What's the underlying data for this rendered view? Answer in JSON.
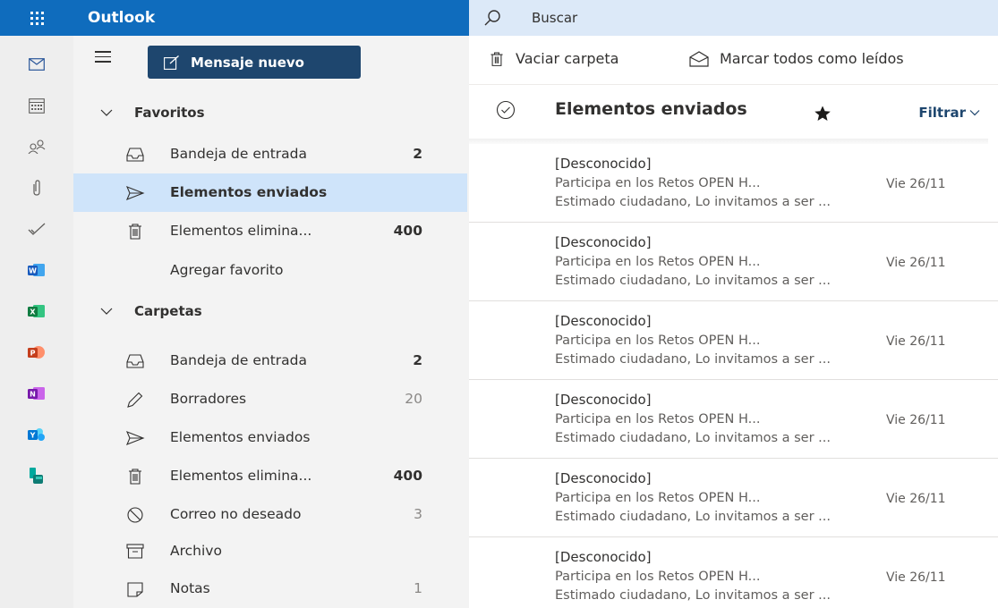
{
  "topbar": {
    "app_name": "Outlook",
    "search_placeholder": "Buscar",
    "accent": "#0f6cbd"
  },
  "rail": {
    "items": [
      "mail-icon",
      "calendar-icon",
      "people-icon",
      "attachment-icon",
      "todo-icon",
      "word-icon",
      "excel-icon",
      "powerpoint-icon",
      "onenote-icon",
      "yammer-icon",
      "bookings-icon"
    ]
  },
  "folderpane": {
    "new_message_label": "Mensaje nuevo",
    "favorites": {
      "title": "Favoritos",
      "items": [
        {
          "label": "Bandeja de entrada",
          "count": "2"
        },
        {
          "label": "Elementos enviados",
          "count": ""
        },
        {
          "label": "Elementos elimina...",
          "count": "400"
        }
      ],
      "add_label": "Agregar favorito"
    },
    "folders": {
      "title": "Carpetas",
      "items": [
        {
          "label": "Bandeja de entrada",
          "count": "2"
        },
        {
          "label": "Borradores",
          "count": "20"
        },
        {
          "label": "Elementos enviados",
          "count": ""
        },
        {
          "label": "Elementos elimina...",
          "count": "400"
        },
        {
          "label": "Correo no deseado",
          "count": "3"
        },
        {
          "label": "Archivo",
          "count": ""
        },
        {
          "label": "Notas",
          "count": "1"
        }
      ]
    }
  },
  "commandbar": {
    "empty_folder": "Vaciar carpeta",
    "mark_all_read": "Marcar todos como leídos"
  },
  "list": {
    "title": "Elementos enviados",
    "filter_label": "Filtrar",
    "messages": [
      {
        "sender": "[Desconocido]",
        "subject": "Participa en los Retos OPEN H...",
        "date": "Vie 26/11",
        "preview": "Estimado ciudadano, Lo invitamos a ser ..."
      },
      {
        "sender": "[Desconocido]",
        "subject": "Participa en los Retos OPEN H...",
        "date": "Vie 26/11",
        "preview": "Estimado ciudadano, Lo invitamos a ser ..."
      },
      {
        "sender": "[Desconocido]",
        "subject": "Participa en los Retos OPEN H...",
        "date": "Vie 26/11",
        "preview": "Estimado ciudadano, Lo invitamos a ser ..."
      },
      {
        "sender": "[Desconocido]",
        "subject": "Participa en los Retos OPEN H...",
        "date": "Vie 26/11",
        "preview": "Estimado ciudadano, Lo invitamos a ser ..."
      },
      {
        "sender": "[Desconocido]",
        "subject": "Participa en los Retos OPEN H...",
        "date": "Vie 26/11",
        "preview": "Estimado ciudadano, Lo invitamos a ser ..."
      },
      {
        "sender": "[Desconocido]",
        "subject": "Participa en los Retos OPEN H...",
        "date": "Vie 26/11",
        "preview": "Estimado ciudadano, Lo invitamos a ser ..."
      }
    ]
  }
}
